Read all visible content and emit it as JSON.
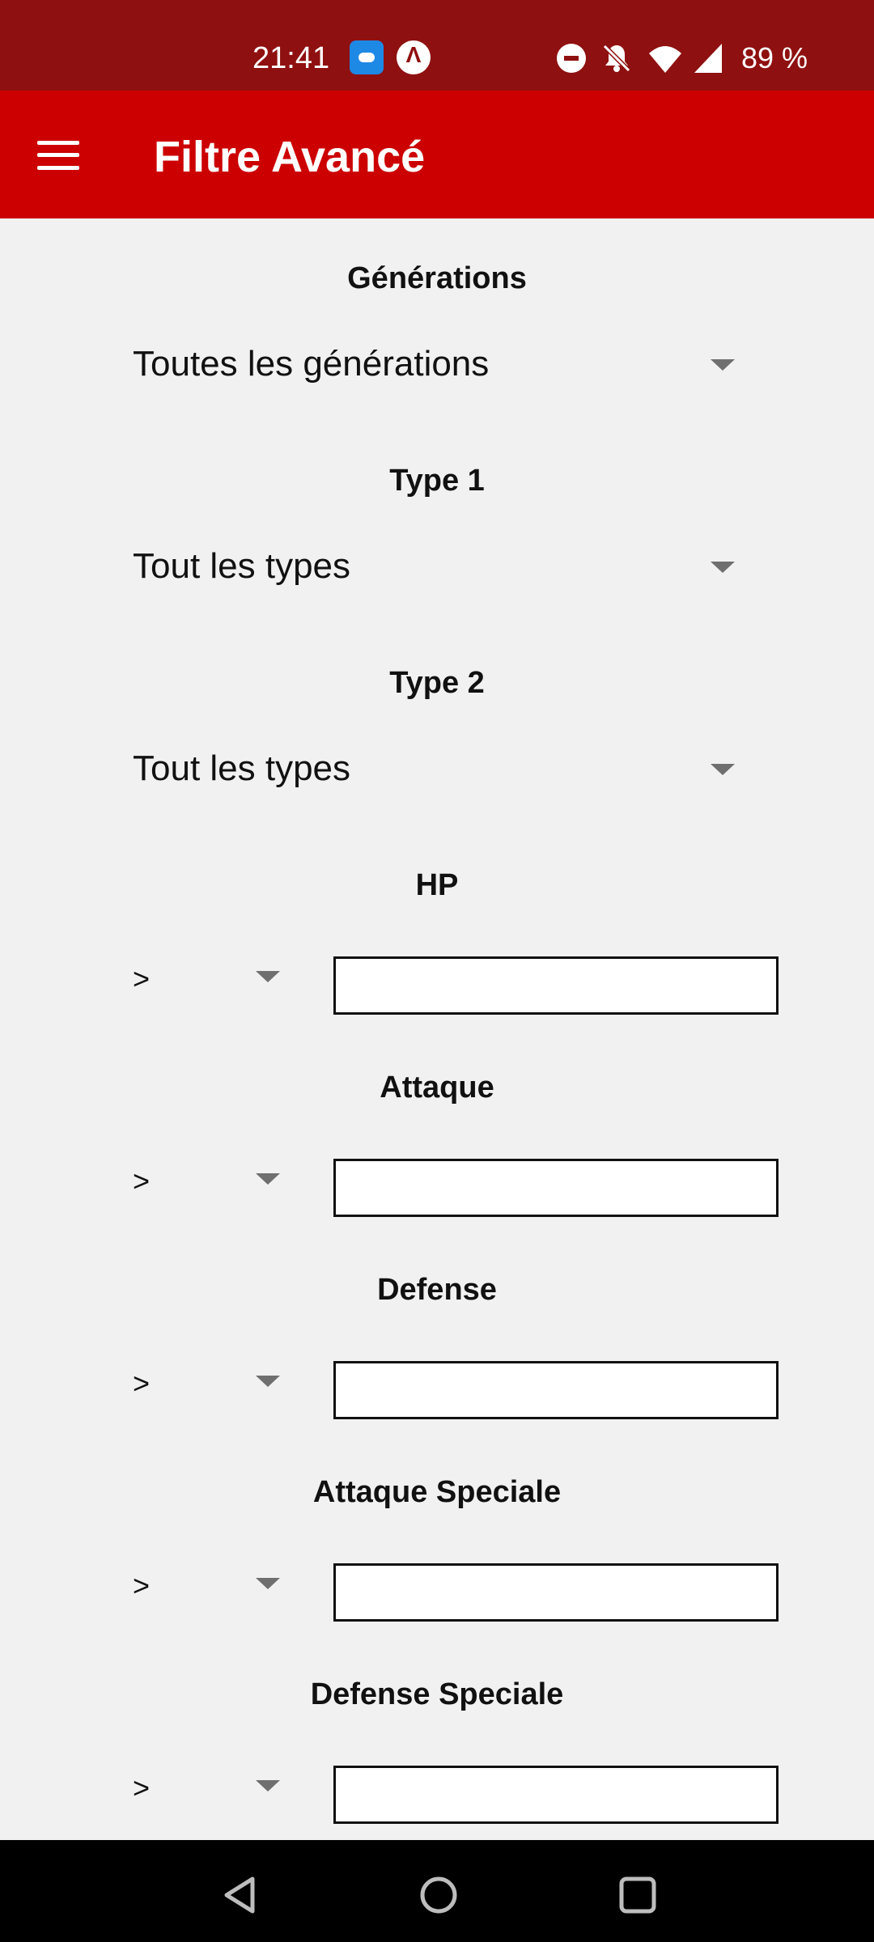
{
  "status_bar": {
    "time": "21:41",
    "battery": "89 %",
    "icons": [
      "app-notification-icon",
      "app-notification-icon",
      "do-not-disturb-icon",
      "bell-off-icon",
      "wifi-icon",
      "signal-icon"
    ]
  },
  "app_bar": {
    "title": "Filtre Avancé",
    "menu_icon": "hamburger-menu-icon",
    "background": "#cc0000"
  },
  "filters": {
    "generations": {
      "label": "Générations",
      "value": "Toutes les générations"
    },
    "type1": {
      "label": "Type 1",
      "value": "Tout les types"
    },
    "type2": {
      "label": "Type 2",
      "value": "Tout les types"
    }
  },
  "stats": [
    {
      "label": "HP",
      "operator": ">",
      "value": ""
    },
    {
      "label": "Attaque",
      "operator": ">",
      "value": ""
    },
    {
      "label": "Defense",
      "operator": ">",
      "value": ""
    },
    {
      "label": "Attaque Speciale",
      "operator": ">",
      "value": ""
    },
    {
      "label": "Defense Speciale",
      "operator": ">",
      "value": ""
    }
  ],
  "nav_bar": {
    "icons": [
      "back-icon",
      "home-icon",
      "recent-apps-icon"
    ]
  }
}
